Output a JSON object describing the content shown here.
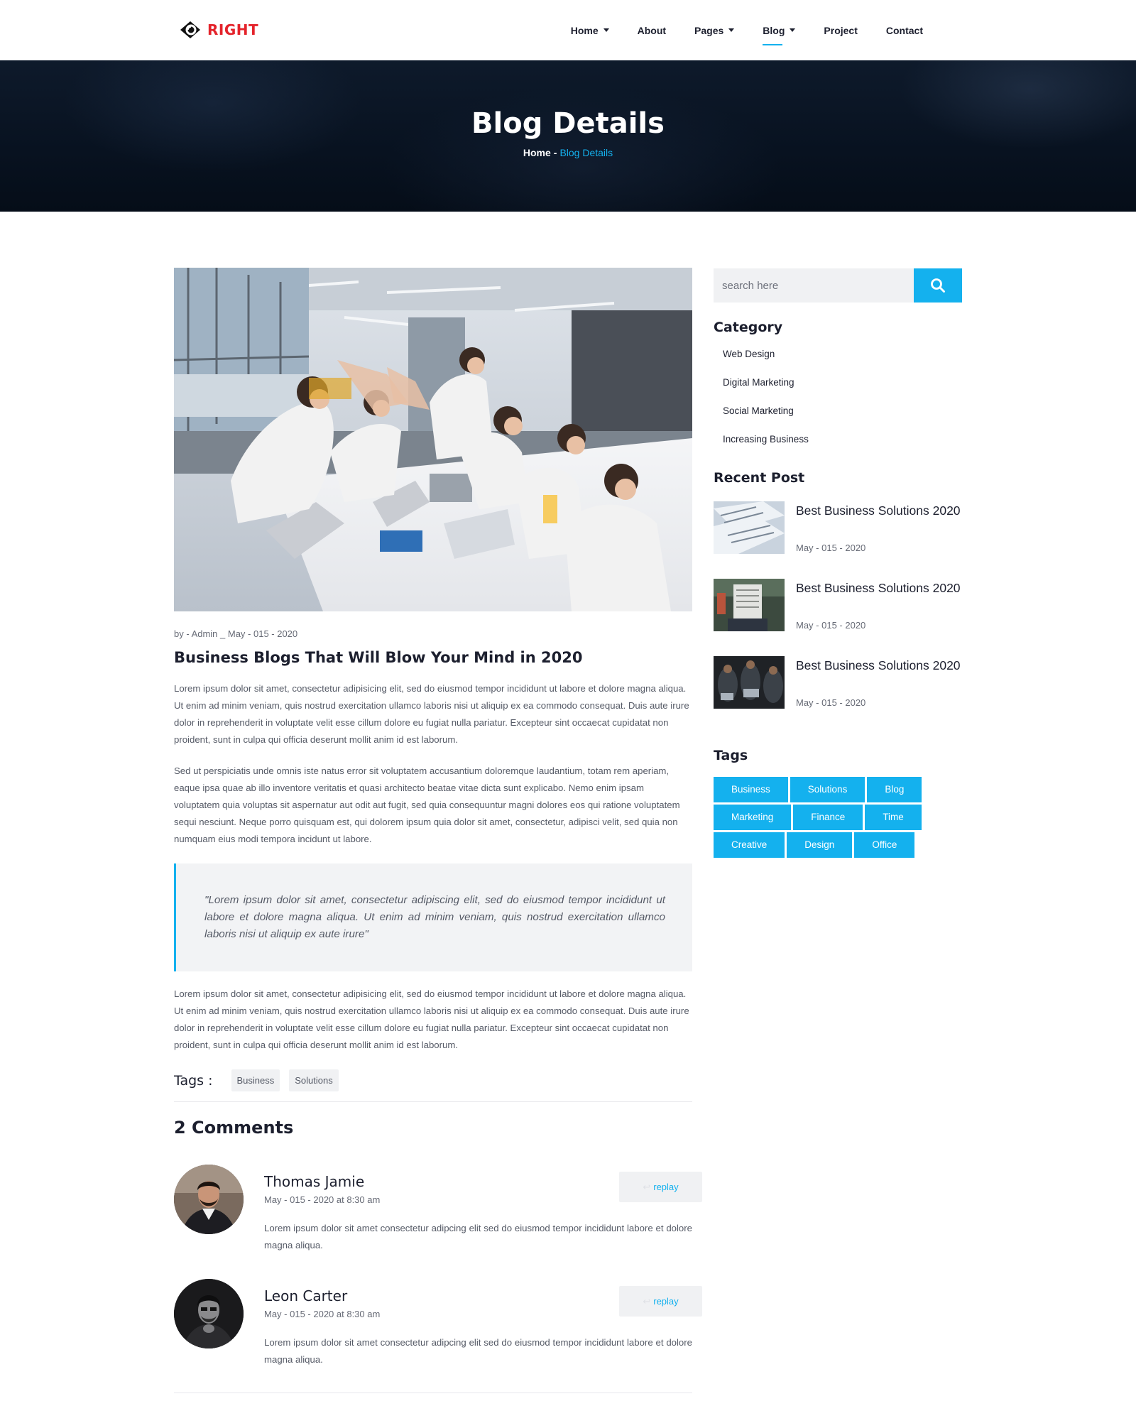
{
  "brand": {
    "name": "RIGHT",
    "color": "#e4232b",
    "icon": "eye-logo-icon"
  },
  "nav": {
    "items": [
      {
        "label": "Home",
        "dropdown": true,
        "active": false
      },
      {
        "label": "About",
        "dropdown": false,
        "active": false
      },
      {
        "label": "Pages",
        "dropdown": true,
        "active": false
      },
      {
        "label": "Blog",
        "dropdown": true,
        "active": true
      },
      {
        "label": "Project",
        "dropdown": false,
        "active": false
      },
      {
        "label": "Contact",
        "dropdown": false,
        "active": false
      }
    ]
  },
  "hero": {
    "title": "Blog Details",
    "breadcrumb": {
      "home": "Home",
      "separator": "-",
      "current": "Blog Details"
    }
  },
  "article": {
    "meta": "by - Admin _ May - 015 - 2020",
    "title": "Business Blogs That Will Blow Your Mind in 2020",
    "paragraph1": "Lorem ipsum dolor sit amet, consectetur adipisicing elit, sed do eiusmod tempor incididunt ut labore et dolore magna aliqua. Ut enim ad minim veniam, quis nostrud exercitation ullamco laboris nisi ut aliquip ex ea commodo consequat. Duis aute irure dolor in reprehenderit in voluptate velit esse cillum dolore eu fugiat nulla pariatur. Excepteur sint occaecat cupidatat non proident, sunt in culpa qui officia deserunt mollit anim id est laborum.",
    "paragraph2": "Sed ut perspiciatis unde omnis iste natus error sit voluptatem accusantium doloremque laudantium, totam rem aperiam, eaque ipsa quae ab illo inventore veritatis et quasi architecto beatae vitae dicta sunt explicabo. Nemo enim ipsam voluptatem quia voluptas sit aspernatur aut odit aut fugit, sed quia consequuntur magni dolores eos qui ratione voluptatem sequi nesciunt. Neque porro quisquam est, qui dolorem ipsum quia dolor sit amet, consectetur, adipisci velit, sed quia non numquam eius modi tempora incidunt ut labore.",
    "quote": "\"Lorem ipsum dolor sit amet, consectetur adipiscing elit, sed do eiusmod tempor incididunt ut labore et dolore magna aliqua. Ut enim ad minim veniam, quis nostrud exercitation ullamco laboris nisi ut aliquip ex aute irure\"",
    "paragraph3": "Lorem ipsum dolor sit amet, consectetur adipisicing elit, sed do eiusmod tempor incididunt ut labore et dolore magna aliqua. Ut enim ad minim veniam, quis nostrud exercitation ullamco laboris nisi ut aliquip ex ea commodo consequat. Duis aute irure dolor in reprehenderit in voluptate velit esse cillum dolore eu fugiat nulla pariatur. Excepteur sint occaecat cupidatat non proident, sunt in culpa qui officia deserunt mollit anim id est laborum.",
    "tags_label": "Tags :",
    "tags": [
      "Business",
      "Solutions"
    ]
  },
  "comments": {
    "title": "2 Comments",
    "items": [
      {
        "name": "Thomas Jamie",
        "date": "May - 015 - 2020 at 8:30 am",
        "text": "Lorem ipsum dolor sit amet consectetur adipcing elit sed do eiusmod tempor incididunt labore et dolore magna aliqua.",
        "reply_label": "replay"
      },
      {
        "name": "Leon Carter",
        "date": "May - 015 - 2020 at 8:30 am",
        "text": "Lorem ipsum dolor sit amet consectetur adipcing elit sed do eiusmod tempor incididunt labore et dolore magna aliqua.",
        "reply_label": "replay"
      }
    ]
  },
  "sidebar": {
    "search": {
      "placeholder": "search here",
      "value": ""
    },
    "category": {
      "title": "Category",
      "items": [
        "Web Design",
        "Digital Marketing",
        "Social Marketing",
        "Increasing Business"
      ]
    },
    "recent": {
      "title": "Recent Post",
      "posts": [
        {
          "title": "Best Business Solutions 2020",
          "date": "May - 015 - 2020"
        },
        {
          "title": "Best Business Solutions 2020",
          "date": "May - 015 - 2020"
        },
        {
          "title": "Best Business Solutions 2020",
          "date": "May - 015 - 2020"
        }
      ]
    },
    "tags": {
      "title": "Tags",
      "items": [
        "Business",
        "Solutions",
        "Blog",
        "Marketing",
        "Finance",
        "Time",
        "Creative",
        "Design",
        "Office"
      ]
    }
  },
  "colors": {
    "accent": "#14b1ee",
    "heading": "#1c1f2e",
    "brand": "#e4232b"
  }
}
